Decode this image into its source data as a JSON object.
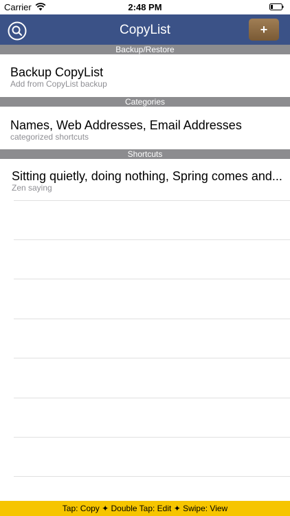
{
  "status_bar": {
    "carrier": "Carrier",
    "time": "2:48 PM"
  },
  "nav": {
    "title": "CopyList",
    "add_label": "+",
    "search_icon": "search-icon",
    "bar_color": "#3b5287"
  },
  "sections": {
    "backup": {
      "header": "Backup/Restore",
      "item_title": "Backup CopyList",
      "item_sub": "Add from CopyList backup"
    },
    "categories": {
      "header": "Categories",
      "item_title": "Names, Web Addresses, Email Addresses",
      "item_sub": "categorized shortcuts"
    },
    "shortcuts": {
      "header": "Shortcuts",
      "item_title": "Sitting quietly, doing nothing, Spring comes and...",
      "item_sub": "Zen saying"
    }
  },
  "footer": {
    "hint": "Tap: Copy ✦ Double Tap: Edit ✦ Swipe: View",
    "color": "#f6c500"
  }
}
